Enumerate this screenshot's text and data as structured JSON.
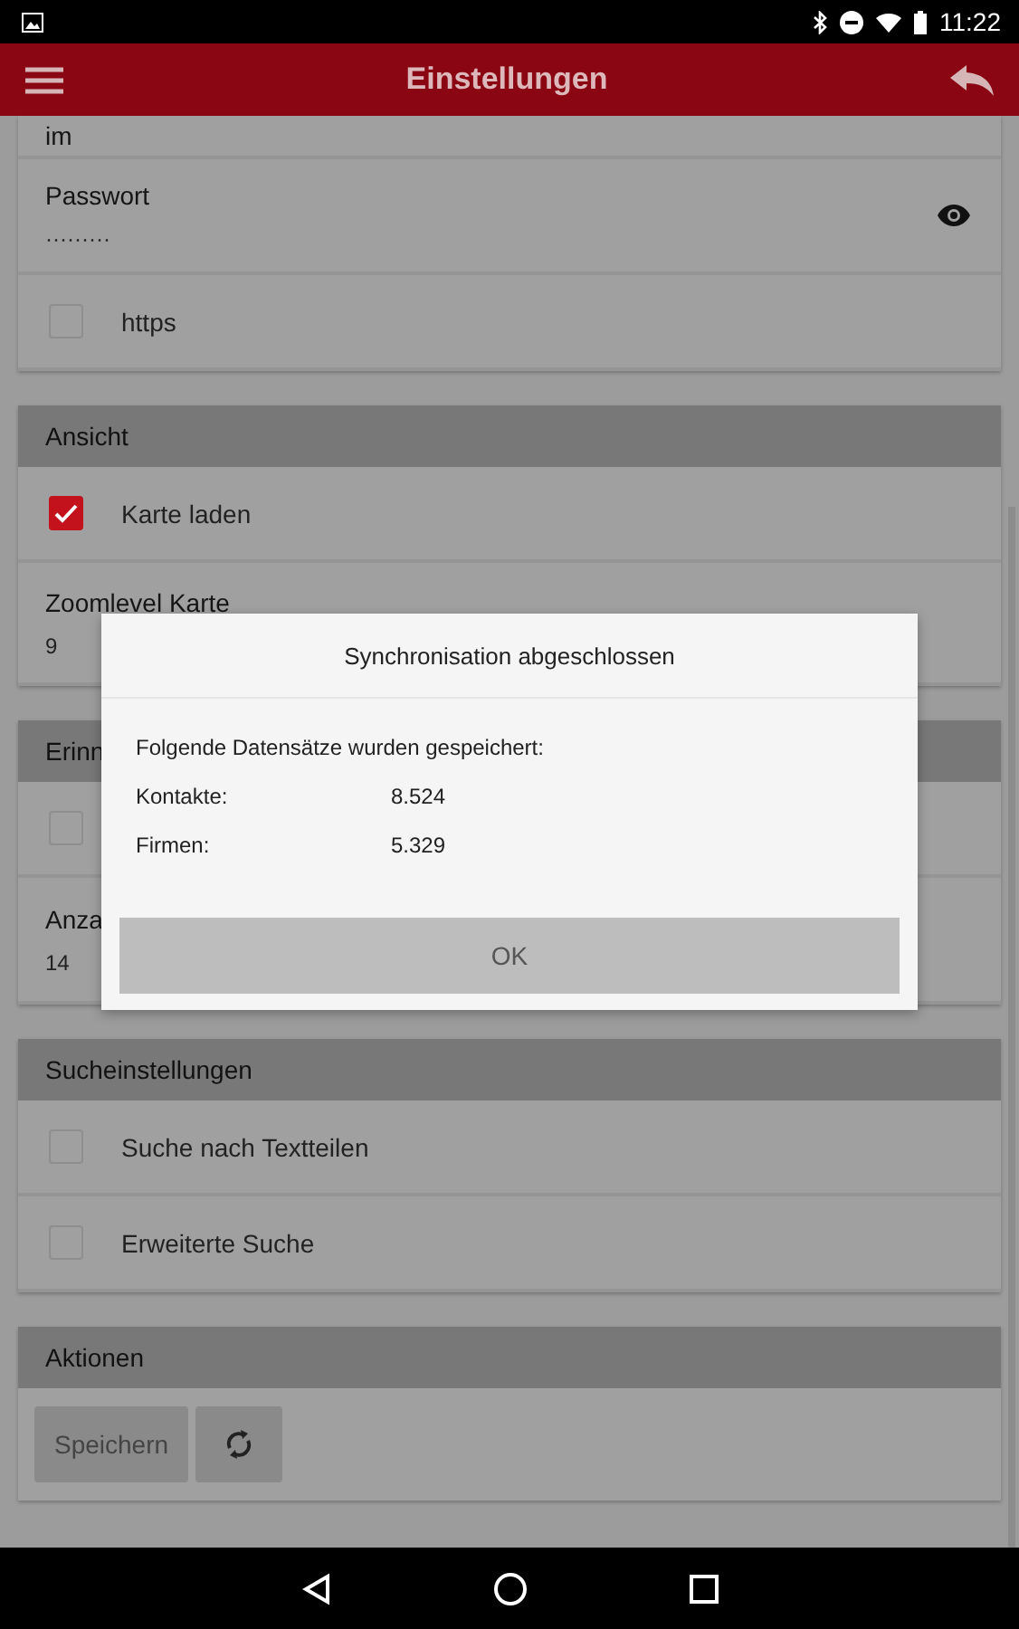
{
  "status_bar": {
    "time": "11:22"
  },
  "app_bar": {
    "title": "Einstellungen"
  },
  "sections": [
    {
      "rows": [
        {
          "kind": "clipped",
          "label": "im"
        },
        {
          "kind": "password",
          "label": "Passwort",
          "value": "·········"
        },
        {
          "kind": "checkbox",
          "label": "https",
          "checked": false
        }
      ]
    },
    {
      "header": "Ansicht",
      "rows": [
        {
          "kind": "checkbox",
          "label": "Karte laden",
          "checked": true
        },
        {
          "kind": "field",
          "label": "Zoomlevel Karte",
          "value": "9"
        }
      ]
    },
    {
      "header": "Erinn",
      "rows": [
        {
          "kind": "checkbox",
          "label": null,
          "checked": false
        },
        {
          "kind": "field",
          "label": "Anza",
          "value": "14"
        }
      ]
    },
    {
      "header": "Sucheinstellungen",
      "rows": [
        {
          "kind": "checkbox",
          "label": "Suche nach Textteilen",
          "checked": false
        },
        {
          "kind": "checkbox",
          "label": "Erweiterte Suche",
          "checked": false
        }
      ]
    },
    {
      "header": "Aktionen",
      "rows": [
        {
          "kind": "actions",
          "save_label": "Speichern"
        }
      ]
    }
  ],
  "dialog": {
    "title": "Synchronisation abgeschlossen",
    "message": "Folgende Datensätze wurden gespeichert:",
    "stats": [
      {
        "label": "Kontakte:",
        "value": "8.524"
      },
      {
        "label": "Firmen:",
        "value": "5.329"
      }
    ],
    "button": "OK"
  }
}
